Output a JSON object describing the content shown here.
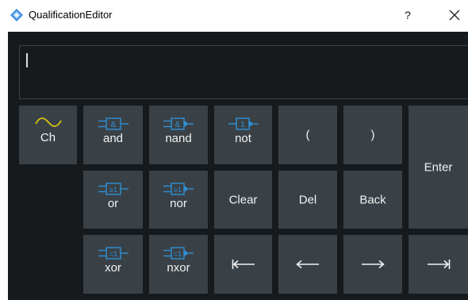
{
  "window": {
    "title": "QualificationEditor",
    "help_label": "?"
  },
  "editor": {
    "expression": ""
  },
  "keys": {
    "ch": "Ch",
    "and": "and",
    "and_sym": "&",
    "nand": "nand",
    "nand_sym": "&",
    "not": "not",
    "not_sym": "1",
    "open_paren": "(",
    "close_paren": ")",
    "enter": "Enter",
    "or": "or",
    "or_sym": "≥1",
    "nor": "nor",
    "nor_sym": "≥1",
    "clear": "Clear",
    "del": "Del",
    "back": "Back",
    "xor": "xor",
    "xor_sym": "=1",
    "nxor": "nxor",
    "nxor_sym": "=1"
  },
  "icons": [
    "app-diamond-icon",
    "help-icon",
    "close-icon",
    "sine-wave-icon",
    "gate-icon",
    "home-arrow-icon",
    "left-arrow-icon",
    "right-arrow-icon",
    "end-arrow-icon"
  ],
  "colors": {
    "panel_bg": "#161a1d",
    "key_bg": "#3a4146",
    "gate_blue": "#2f8fd6",
    "wave_yellow": "#e8d210",
    "key_text": "#f2f2f2"
  }
}
